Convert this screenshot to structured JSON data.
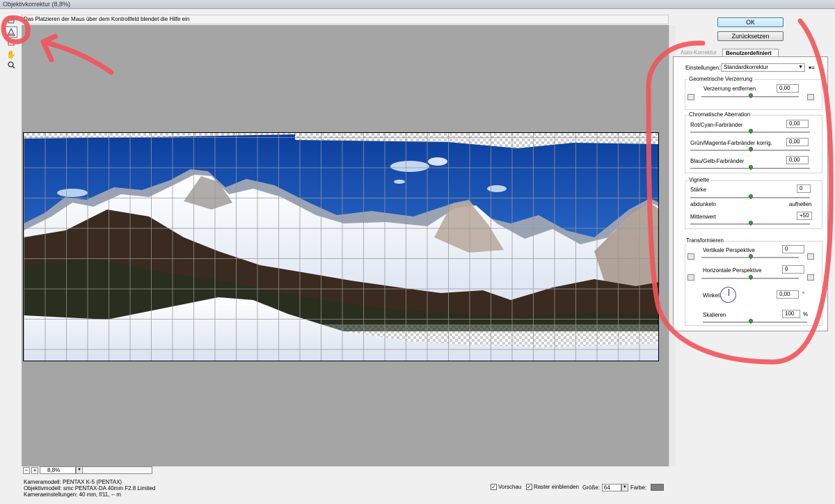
{
  "window": {
    "title": "Objektivkorrektur (8,8%)"
  },
  "hint": "Das Platzieren der Maus über dem Kontrollfeld blendet die Hilfe ein",
  "tools": [
    {
      "name": "distortion-tool-icon"
    },
    {
      "name": "straighten-tool-icon"
    },
    {
      "name": "move-grid-tool-icon"
    },
    {
      "name": "hand-tool-icon"
    },
    {
      "name": "zoom-tool-icon"
    }
  ],
  "zoom": {
    "minus": "−",
    "plus": "+",
    "value": "8,8%"
  },
  "info": {
    "camera": "Kameramodell: PENTAX K-5 (PENTAX)",
    "lens": "Objektivmodell: smc PENTAX-DA 40mm F2.8 Limited",
    "settings": "Kameraeinstellungen: 40 mm, f/11, -- m"
  },
  "status": {
    "preview_label": "Vorschau",
    "preview_checked": true,
    "grid_label": "Raster einblenden",
    "grid_checked": true,
    "size_label": "Größe:",
    "size_value": "64",
    "color_label": "Farbe:",
    "color_value": "#808080"
  },
  "buttons": {
    "ok": "OK",
    "reset": "Zurücksetzen"
  },
  "tabs": {
    "auto": "Auto-Korrektur",
    "custom": "Benutzerdefiniert"
  },
  "settings": {
    "label": "Einstellungen:",
    "value": "Standardkorrektur",
    "menu_icon": "▾≡"
  },
  "geometric": {
    "title": "Geometrische Verzerrung",
    "remove_label": "Verzerrung entfernen",
    "remove_value": "0,00"
  },
  "chromatic": {
    "title": "Chromatische Aberration",
    "red_cyan_label": "Rot/Cyan-Farbränder",
    "red_cyan_value": "0,00",
    "green_magenta_label": "Grün/Magenta-Farbränder korrig.",
    "green_magenta_value": "0,00",
    "blue_yellow_label": "Blau/Gelb-Farbränder",
    "blue_yellow_value": "0,00"
  },
  "vignette": {
    "title": "Vignette",
    "amount_label": "Stärke",
    "amount_value": "0",
    "darken_label": "abdunkeln",
    "lighten_label": "aufhellen",
    "midpoint_label": "Mittenwert",
    "midpoint_value": "+50"
  },
  "transform": {
    "title": "Transformieren",
    "vertical_label": "Vertikale Perspektive",
    "vertical_value": "0",
    "horizontal_label": "Horizontale Perspektive",
    "horizontal_value": "0",
    "angle_label": "Winkel:",
    "angle_value": "0,00",
    "angle_unit": "°",
    "scale_label": "Skalieren",
    "scale_value": "100",
    "scale_unit": "%"
  },
  "annotation_color": "#f2545b"
}
